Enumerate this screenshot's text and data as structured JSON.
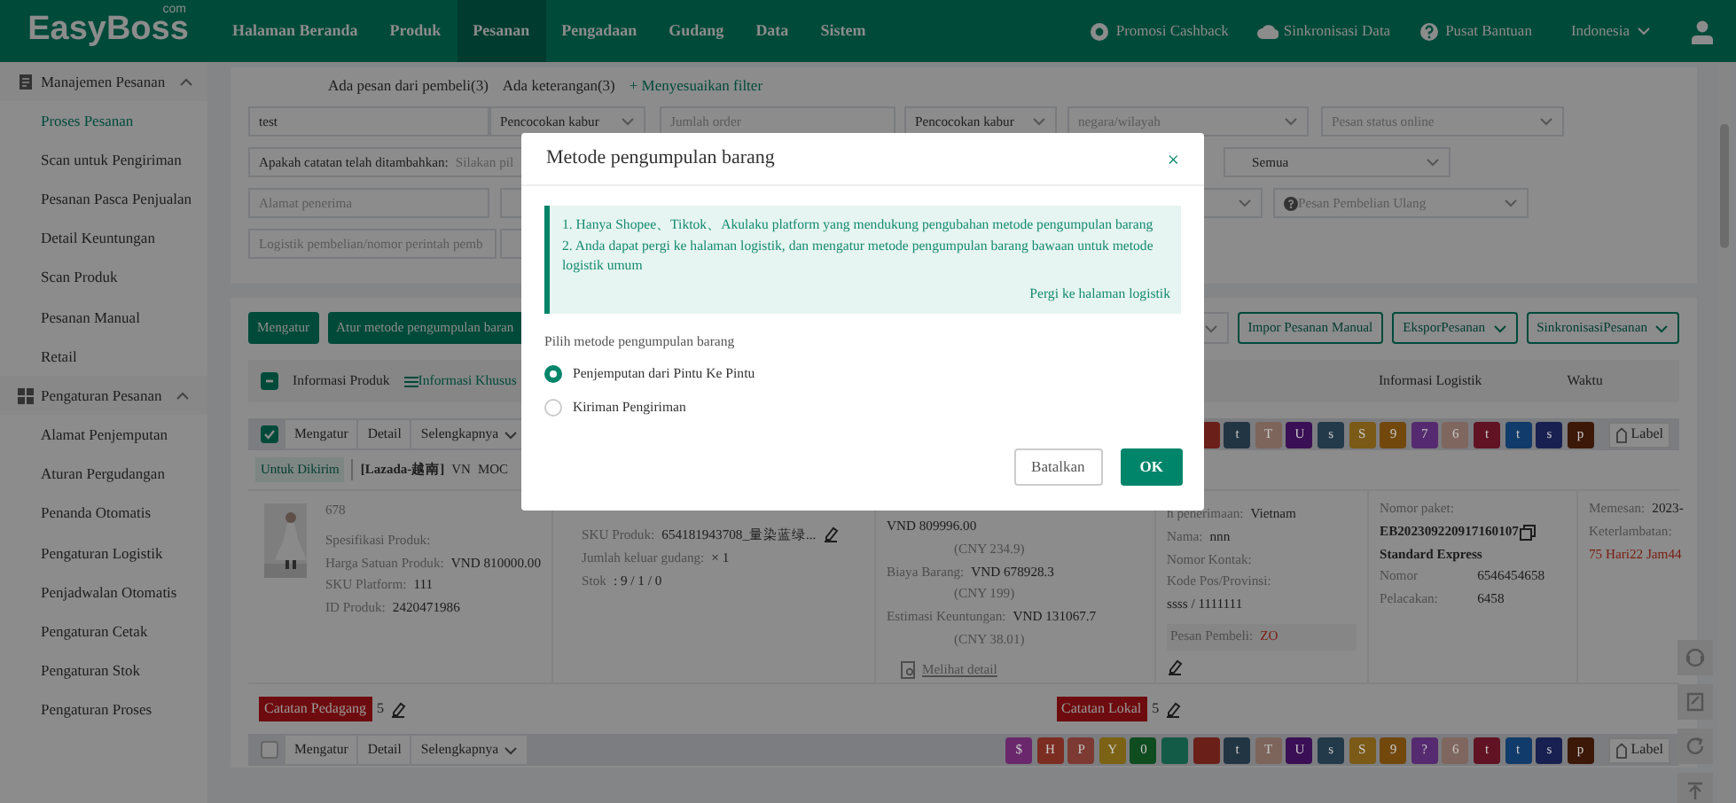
{
  "nav": {
    "logo": "EasyBoss",
    "logo_suffix": "com",
    "items": [
      {
        "label": "Halaman Beranda",
        "selected": false
      },
      {
        "label": "Produk",
        "selected": false
      },
      {
        "label": "Pesanan",
        "selected": true
      },
      {
        "label": "Pengadaan",
        "selected": false
      },
      {
        "label": "Gudang",
        "selected": false
      },
      {
        "label": "Data",
        "selected": false
      },
      {
        "label": "Sistem",
        "selected": false
      }
    ],
    "tools": [
      {
        "kind": "cashback",
        "label": "Promosi Cashback"
      },
      {
        "kind": "sync",
        "label": "Sinkronisasi Data"
      },
      {
        "kind": "help",
        "label": "Pusat Bantuan"
      }
    ],
    "language": "Indonesia"
  },
  "sidebar": {
    "groups": [
      {
        "title": "Manajemen Pesanan",
        "kind": "orders",
        "expanded": true,
        "items": [
          {
            "label": "Proses Pesanan",
            "selected": true
          },
          {
            "label": "Scan untuk Pengiriman",
            "selected": false
          },
          {
            "label": "Pesanan Pasca Penjualan",
            "selected": false
          },
          {
            "label": "Detail Keuntungan",
            "selected": false
          },
          {
            "label": "Scan Produk",
            "selected": false
          },
          {
            "label": "Pesanan Manual",
            "selected": false
          },
          {
            "label": "Retail",
            "selected": false
          }
        ]
      },
      {
        "title": "Pengaturan Pesanan",
        "kind": "settings",
        "expanded": true,
        "items": [
          {
            "label": "Alamat Penjemputan",
            "selected": false
          },
          {
            "label": "Aturan Pergudangan",
            "selected": false
          },
          {
            "label": "Penanda Otomatis",
            "selected": false
          },
          {
            "label": "Pengaturan Logistik",
            "selected": false
          },
          {
            "label": "Penjadwalan Otomatis",
            "selected": false
          },
          {
            "label": "Pengaturan Cetak",
            "selected": false
          },
          {
            "label": "Pengaturan Stok",
            "selected": false
          },
          {
            "label": "Pengaturan Proses",
            "selected": false
          }
        ]
      }
    ]
  },
  "quick_filters": [
    {
      "kind": "filter",
      "label": "Ada pesan dari pembeli(3)"
    },
    {
      "kind": "filter",
      "label": "Ada keterangan(3)"
    },
    {
      "kind": "link",
      "label": "+ Menyesuaikan filter"
    }
  ],
  "filter_rows": [
    [
      {
        "kind": "input",
        "value": "test"
      },
      {
        "kind": "select",
        "value": "Pencocokan kabur"
      },
      {
        "kind": "input",
        "placeholder": "Jumlah order"
      },
      {
        "kind": "select",
        "value": "Pencocokan kabur"
      },
      {
        "kind": "select",
        "placeholder": "negara/wilayah"
      },
      {
        "kind": "select",
        "placeholder": "Pesan status online"
      }
    ],
    [
      {
        "kind": "labeled",
        "label": "Apakah catatan telah ditambahkan:",
        "placeholder": "Silakan pil"
      },
      {
        "kind": "select",
        "value": "Semua"
      }
    ],
    [
      {
        "kind": "input",
        "placeholder": "Alamat penerima"
      },
      {
        "kind": "select"
      },
      {
        "kind": "help-select",
        "placeholder": "Pesan Pembelian Ulang"
      }
    ],
    [
      {
        "kind": "input",
        "placeholder": "Logistik pembelian/nomor perintah pemb"
      },
      {
        "kind": "input"
      }
    ]
  ],
  "toolbar": {
    "left": [
      {
        "kind": "primary",
        "label": "Mengatur"
      },
      {
        "kind": "primary",
        "label": "Atur metode pengumpulan baran"
      }
    ],
    "right": [
      {
        "kind": "select"
      },
      {
        "kind": "outline",
        "label": "Impor Pesanan Manual"
      },
      {
        "kind": "dropdown",
        "label": "EksporPesanan"
      },
      {
        "kind": "dropdown",
        "label": "SinkronisasiPesanan"
      }
    ]
  },
  "table_header": {
    "indeterminate": true,
    "product": "Informasi Produk",
    "special": "Informasi Khusus",
    "logistics": "Informasi Logistik",
    "time": "Waktu"
  },
  "orders": [
    {
      "checked": true,
      "actions": [
        "Mengatur",
        "Detail",
        "Selengkapnya"
      ],
      "tags": [
        {
          "color": "#6a1f18"
        },
        {
          "text": "t",
          "color": "#223543"
        },
        {
          "text": "T",
          "color": "#7d655c"
        },
        {
          "text": "U",
          "color": "#3a0f55"
        },
        {
          "text": "s",
          "color": "#233a4a"
        },
        {
          "text": "S",
          "color": "#7b5a17"
        },
        {
          "text": "9",
          "color": "#72480d"
        },
        {
          "text": "7",
          "color": "#562a70"
        },
        {
          "text": "6",
          "color": "#7f665e"
        },
        {
          "text": "t",
          "color": "#611323"
        },
        {
          "text": "t",
          "color": "#113b6a"
        },
        {
          "text": "s",
          "color": "#182051"
        },
        {
          "text": "p",
          "color": "#3c1808"
        }
      ],
      "label_button": "Label",
      "status": "Untuk Dikirim",
      "shop": "[Lazada-越南]",
      "country": "VN",
      "order_no": "MOC",
      "product": {
        "name": "678",
        "spec": "Spesifikasi Produk:",
        "price_label": "Harga Satuan Produk:",
        "price": "VND 810000.00",
        "sku_label": "SKU Platform:",
        "sku": "111",
        "id_label": "ID Produk:",
        "id": "2420471986"
      },
      "stock": [
        {
          "label": "SKU Produk:",
          "value": "654181943708_量染蓝绿..."
        },
        {
          "label": "Jumlah keluar gudang:",
          "value": "× 1"
        },
        {
          "label": "Stok",
          "value": ": 9 / 1 / 0"
        }
      ],
      "finance": [
        {
          "value": "VND 809996.00"
        },
        {
          "note": "(CNY 234.9)"
        },
        {
          "label": "Biaya Barang:",
          "value": "VND 678928.3"
        },
        {
          "note": "(CNY 199)"
        },
        {
          "label": "Estimasi Keuntungan:",
          "value": "VND 131067.7"
        },
        {
          "note": "(CNY 38.01)"
        }
      ],
      "detail_link": "Melihat detail",
      "recipient": [
        {
          "label": "h penerimaan:",
          "value": "Vietnam"
        },
        {
          "label": "Nama:",
          "value": "nnn"
        },
        {
          "label": "Nomor Kontak:"
        },
        {
          "label": "Kode Pos/Provinsi:"
        },
        {
          "value": "ssss / 1111111"
        }
      ],
      "buyer_note": {
        "label": "Pesan Pembeli:",
        "value": "ZO"
      },
      "logistics": [
        {
          "label": "Nomor paket:"
        },
        {
          "value": "EB202309220917160107",
          "copy": true
        },
        {
          "value": "Standard Express"
        },
        {
          "label": "Nomor Pelacakan:",
          "value": "6546454658 6458"
        }
      ],
      "time": [
        {
          "label": "Memesan:",
          "value": "2023-",
          "late": false
        },
        {
          "label": "Keterlambatan:"
        },
        {
          "value": "75 Hari22 Jam44",
          "late": true
        }
      ],
      "notes": [
        {
          "label": "Catatan Pedagang",
          "count": "5"
        },
        {
          "label": "Catatan Lokal",
          "count": "5"
        }
      ]
    },
    {
      "checked": false,
      "actions": [
        "Mengatur",
        "Detail",
        "Selengkapnya"
      ],
      "tags": [
        {
          "text": "$",
          "color": "#6b276b"
        },
        {
          "text": "H",
          "color": "#7c2d21"
        },
        {
          "text": "P",
          "color": "#7c3a32"
        },
        {
          "text": "Y",
          "color": "#7b6214"
        },
        {
          "text": "0",
          "color": "#0f4c20"
        },
        {
          "color": "#135b46"
        },
        {
          "color": "#6a1f18"
        },
        {
          "text": "t",
          "color": "#223543"
        },
        {
          "text": "T",
          "color": "#7d655c"
        },
        {
          "text": "U",
          "color": "#3a0f55"
        },
        {
          "text": "s",
          "color": "#233a4a"
        },
        {
          "text": "S",
          "color": "#7b5a17"
        },
        {
          "text": "9",
          "color": "#72480d"
        },
        {
          "text": "?",
          "color": "#562a70"
        },
        {
          "text": "6",
          "color": "#7f665e"
        },
        {
          "text": "t",
          "color": "#611323"
        },
        {
          "text": "t",
          "color": "#113b6a"
        },
        {
          "text": "s",
          "color": "#182051"
        },
        {
          "text": "p",
          "color": "#3c1808"
        }
      ],
      "label_button": "Label"
    }
  ],
  "float_tools": [
    {
      "kind": "support"
    },
    {
      "kind": "note"
    },
    {
      "kind": "refresh"
    },
    {
      "kind": "top"
    }
  ],
  "dialog": {
    "title": "Metode pengumpulan barang",
    "close": "×",
    "info": [
      "1. Hanya Shopee、Tiktok、Akulaku platform yang mendukung pengubahan metode pengumpulan barang",
      "2. Anda dapat pergi ke halaman logistik, dan mengatur metode pengumpulan barang bawaan untuk metode logistik umum"
    ],
    "link": "Pergi ke halaman logistik",
    "prompt": "Pilih metode pengumpulan barang",
    "options": [
      {
        "label": "Penjemputan dari Pintu Ke Pintu",
        "selected": true
      },
      {
        "label": "Kiriman Pengiriman",
        "selected": false
      }
    ],
    "buttons": [
      {
        "kind": "cancel",
        "label": "Batalkan"
      },
      {
        "kind": "ok",
        "label": "OK"
      }
    ]
  }
}
